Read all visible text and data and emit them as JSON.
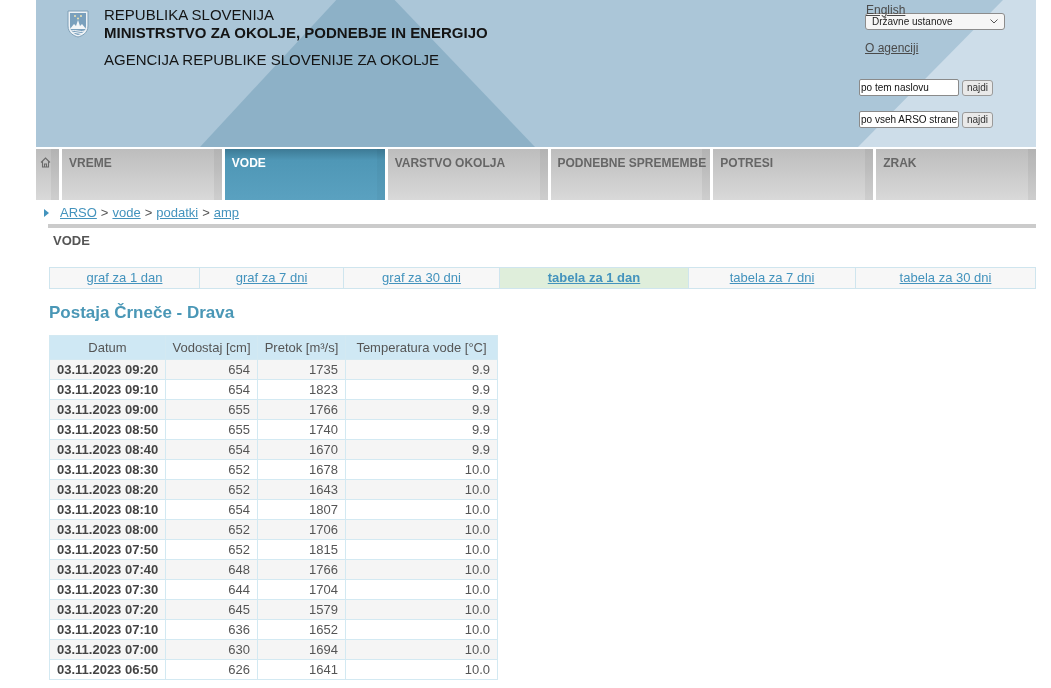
{
  "header": {
    "country": "REPUBLIKA SLOVENIJA",
    "ministry": "MINISTRSTVO ZA OKOLJE, PODNEBJE IN ENERGIJO",
    "agency": "AGENCIJA REPUBLIKE SLOVENIJE ZA OKOLJE",
    "language_link": "English",
    "institutions_select": "Državne ustanove",
    "about_link": "O agenciji",
    "searches": [
      {
        "value": "po tem naslovu",
        "button": "najdi"
      },
      {
        "value": "po vseh ARSO strane",
        "button": "najdi"
      }
    ]
  },
  "nav": [
    {
      "label": "VREME",
      "selected": false
    },
    {
      "label": "VODE",
      "selected": true
    },
    {
      "label": "VARSTVO OKOLJA",
      "selected": false
    },
    {
      "label": "PODNEBNE SPREMEMBE",
      "selected": false
    },
    {
      "label": "POTRESI",
      "selected": false
    },
    {
      "label": "ZRAK",
      "selected": false
    }
  ],
  "breadcrumb": [
    {
      "kind": "link",
      "text": "ARSO"
    },
    {
      "kind": "separator",
      "text": ">"
    },
    {
      "kind": "link",
      "text": "vode"
    },
    {
      "kind": "separator",
      "text": ">"
    },
    {
      "kind": "link",
      "text": "podatki"
    },
    {
      "kind": "separator",
      "text": ">"
    },
    {
      "kind": "link",
      "text": "amp"
    }
  ],
  "section_title": "VODE",
  "view_tabs": [
    {
      "label": "graf za 1 dan",
      "selected": false
    },
    {
      "label": "graf za 7 dni",
      "selected": false
    },
    {
      "label": "graf za 30 dni",
      "selected": false
    },
    {
      "label": "tabela za 1 dan",
      "selected": true
    },
    {
      "label": "tabela za 7 dni",
      "selected": false
    },
    {
      "label": "tabela za 30 dni",
      "selected": false
    }
  ],
  "station_title": "Postaja Črneče - Drava",
  "table": {
    "columns": [
      "Datum",
      "Vodostaj [cm]",
      "Pretok [m³/s]",
      "Temperatura vode [°C]"
    ],
    "rows": [
      [
        "03.11.2023 09:20",
        "654",
        "1735",
        "9.9"
      ],
      [
        "03.11.2023 09:10",
        "654",
        "1823",
        "9.9"
      ],
      [
        "03.11.2023 09:00",
        "655",
        "1766",
        "9.9"
      ],
      [
        "03.11.2023 08:50",
        "655",
        "1740",
        "9.9"
      ],
      [
        "03.11.2023 08:40",
        "654",
        "1670",
        "9.9"
      ],
      [
        "03.11.2023 08:30",
        "652",
        "1678",
        "10.0"
      ],
      [
        "03.11.2023 08:20",
        "652",
        "1643",
        "10.0"
      ],
      [
        "03.11.2023 08:10",
        "654",
        "1807",
        "10.0"
      ],
      [
        "03.11.2023 08:00",
        "652",
        "1706",
        "10.0"
      ],
      [
        "03.11.2023 07:50",
        "652",
        "1815",
        "10.0"
      ],
      [
        "03.11.2023 07:40",
        "648",
        "1766",
        "10.0"
      ],
      [
        "03.11.2023 07:30",
        "644",
        "1704",
        "10.0"
      ],
      [
        "03.11.2023 07:20",
        "645",
        "1579",
        "10.0"
      ],
      [
        "03.11.2023 07:10",
        "636",
        "1652",
        "10.0"
      ],
      [
        "03.11.2023 07:00",
        "630",
        "1694",
        "10.0"
      ],
      [
        "03.11.2023 06:50",
        "626",
        "1641",
        "10.0"
      ]
    ]
  }
}
